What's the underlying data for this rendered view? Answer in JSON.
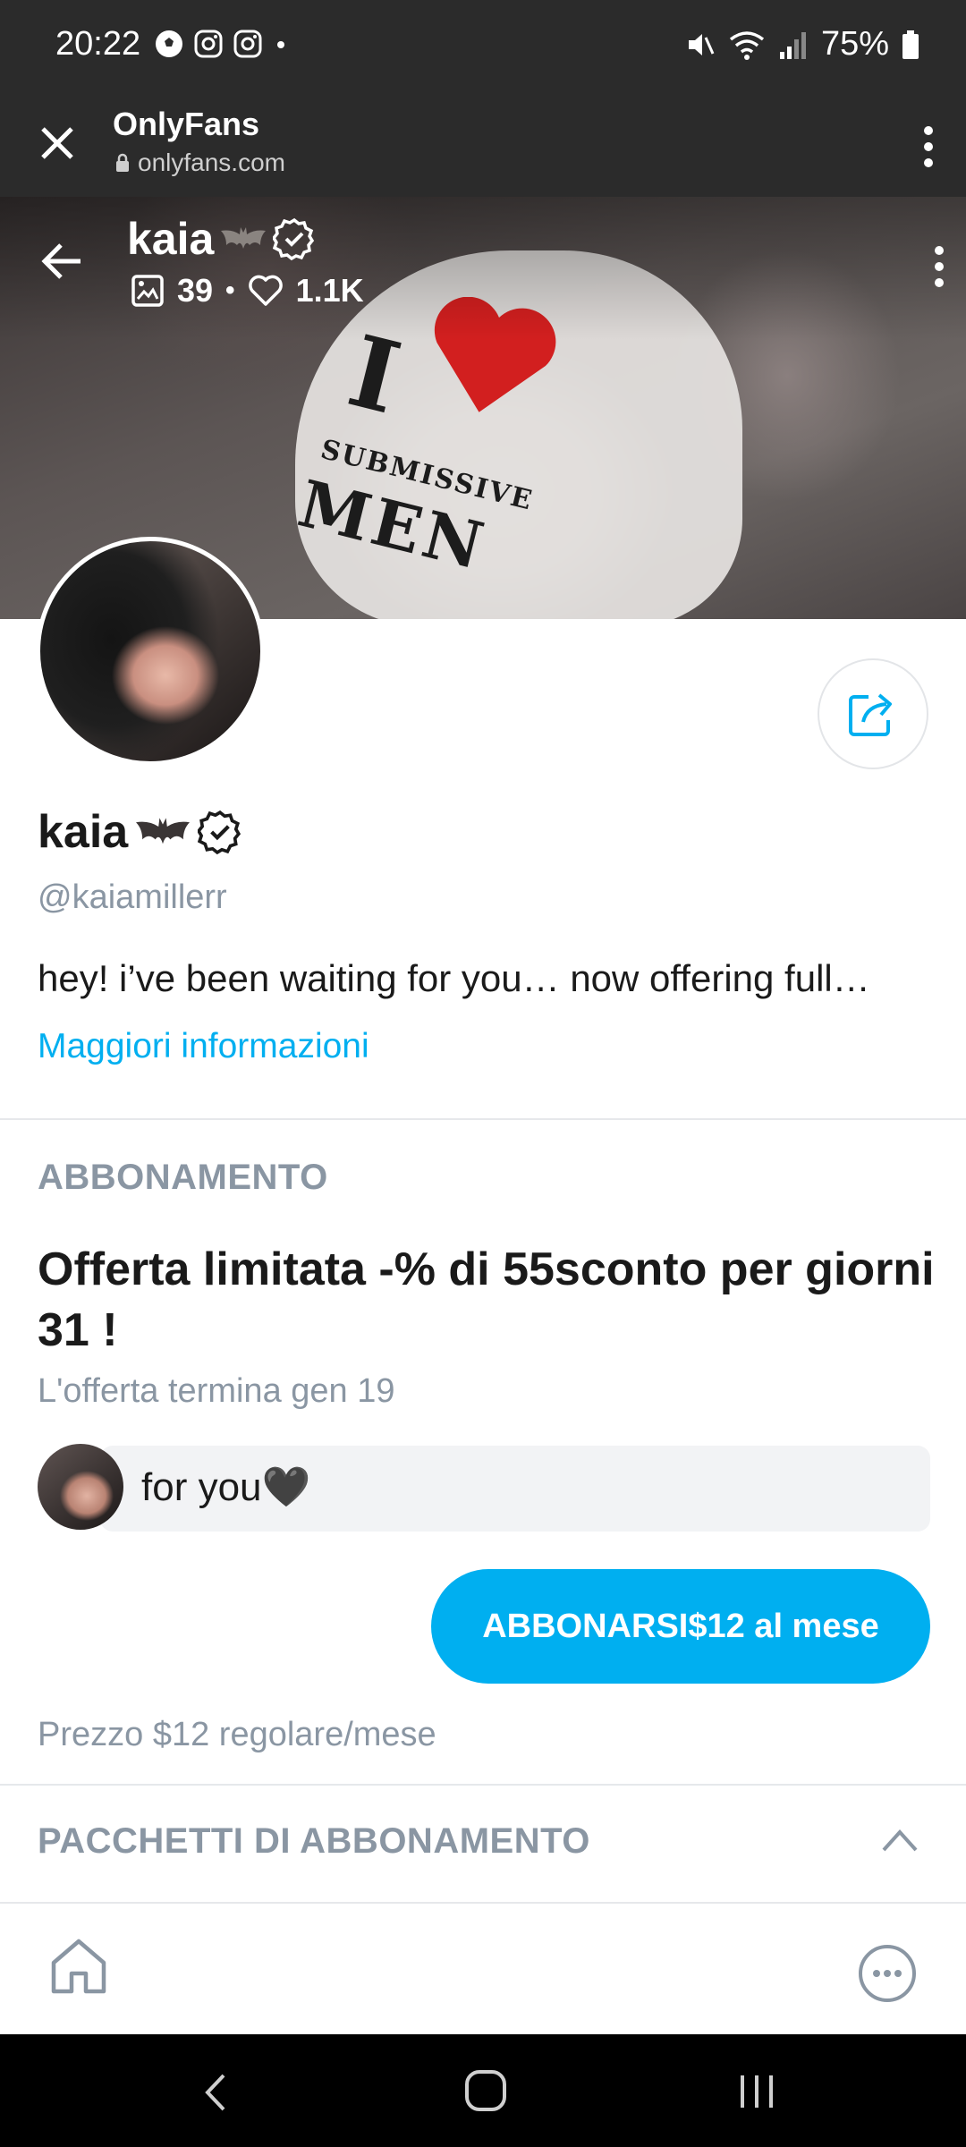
{
  "status_bar": {
    "time": "20:22",
    "battery": "75%",
    "left_icons": [
      "soccer-ball-icon",
      "instagram-icon",
      "instagram-icon",
      "dot-icon"
    ],
    "right_icons": [
      "mute-icon",
      "wifi-icon",
      "signal-icon",
      "battery-icon"
    ]
  },
  "browser": {
    "title": "OnlyFans",
    "url": "onlyfans.com"
  },
  "cover": {
    "name": "kaia",
    "media_count": "39",
    "likes_count": "1.1K",
    "shirt_line1": "I",
    "shirt_line2": "SUBMISSIVE",
    "shirt_line3": "MEN"
  },
  "profile": {
    "name": "kaia",
    "username": "@kaiamillerr",
    "bio": "hey! i’ve been waiting for you… now offering full…",
    "more_link": "Maggiori informazioni"
  },
  "subscription": {
    "section_label": "ABBONAMENTO",
    "offer_title": "Offerta limitata -% di 55sconto per giorni 31 !",
    "offer_end": "L'offerta termina gen 19",
    "message": "for you🖤",
    "subscribe_button": "ABBONARSI$12 al mese",
    "regular_price": "Prezzo $12 regolare/mese"
  },
  "packages": {
    "section_label": "PACCHETTI DI ABBONAMENTO"
  },
  "colors": {
    "accent": "#00aff0",
    "muted_text": "#8a96a3",
    "dark_bar": "#2b2b2b"
  }
}
